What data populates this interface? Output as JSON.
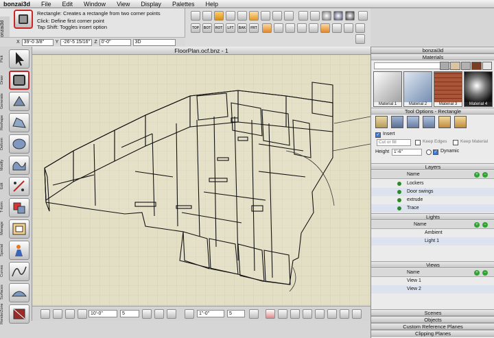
{
  "menu": {
    "app": "bonzai3d",
    "items": [
      "File",
      "Edit",
      "Window",
      "View",
      "Display",
      "Palettes",
      "Help"
    ]
  },
  "tool_info": {
    "app_vertical": "bonzai3d",
    "tool_name": "Rectangle:",
    "description": "Creates a rectangle from two corner points",
    "line1": "Click: Define first corner point",
    "line2": "Tap Shift: Toggles insert option"
  },
  "coords": {
    "x_label": "X",
    "x_value": "39'-0 3/8\"",
    "y_label": "Y",
    "y_value": "-26'-5 15/16\"",
    "z_label": "Z",
    "z_value": "0'-0\"",
    "mode": "3D"
  },
  "view_buttons": [
    "TOP",
    "BOT",
    "ROT",
    "LFT",
    "BAK",
    "FRT"
  ],
  "tools": [
    {
      "label": "Pick",
      "icon": "arrow-cursor-icon"
    },
    {
      "label": "Draw",
      "icon": "rectangle-icon"
    },
    {
      "label": "Generate",
      "icon": "cube-generate-icon"
    },
    {
      "label": "Reshape",
      "icon": "reshape-icon"
    },
    {
      "label": "Deform",
      "icon": "deform-icon"
    },
    {
      "label": "Modify",
      "icon": "modify-icon"
    },
    {
      "label": "Edit",
      "icon": "edit-icon"
    },
    {
      "label": "T-form",
      "icon": "transform-icon"
    },
    {
      "label": "Manage",
      "icon": "manage-icon"
    },
    {
      "label": "Special",
      "icon": "special-icon"
    },
    {
      "label": "Curves",
      "icon": "curves-icon"
    },
    {
      "label": "Surfaces",
      "icon": "surfaces-icon"
    },
    {
      "label": "RenderZone",
      "icon": "render-icon"
    }
  ],
  "viewport": {
    "title": "FloorPlan.ocf.bnz - 1"
  },
  "bottom": {
    "grid_value": "10'-0\"",
    "grid_count": "5",
    "snap_value": "1\"-0\"",
    "snap_count": "5"
  },
  "panel": {
    "title": "bonzai3d",
    "materials_title": "Materials",
    "materials": [
      {
        "name": "Material 1",
        "color": "#e9e9e9"
      },
      {
        "name": "Material 2",
        "color": "#b8c6d9"
      },
      {
        "name": "Material 3",
        "color": "#a8553a"
      },
      {
        "name": "Material 4",
        "color": "#3a3a3a"
      }
    ],
    "tool_options_title": "Tool Options - Rectangle",
    "insert_label": "Insert",
    "cut_or_fill": "Cut or fill",
    "keep_edges": "Keep Edges",
    "keep_material": "Keep Material",
    "height_label": "Height",
    "height_value": "1'-6\"",
    "dynamic_label": "Dynamic",
    "layers_title": "Layers",
    "layers_header": "Name",
    "layers": [
      "Lockers",
      "Door swings",
      "extrude",
      "Trace"
    ],
    "lights_title": "Lights",
    "lights_header": "Name",
    "lights": [
      "Ambient",
      "Light 1"
    ],
    "views_title": "Views",
    "views_header": "Name",
    "views": [
      "View 1",
      "View 2"
    ],
    "collapsed": [
      "Scenes",
      "Objects",
      "Custom Reference Planes",
      "Clipping Planes"
    ]
  },
  "colors": {
    "viewport_bg": "#e3dfc5",
    "grid": "#c9c5a9",
    "selected_tool": "#cc2020",
    "accent_green": "#2fa52f"
  }
}
